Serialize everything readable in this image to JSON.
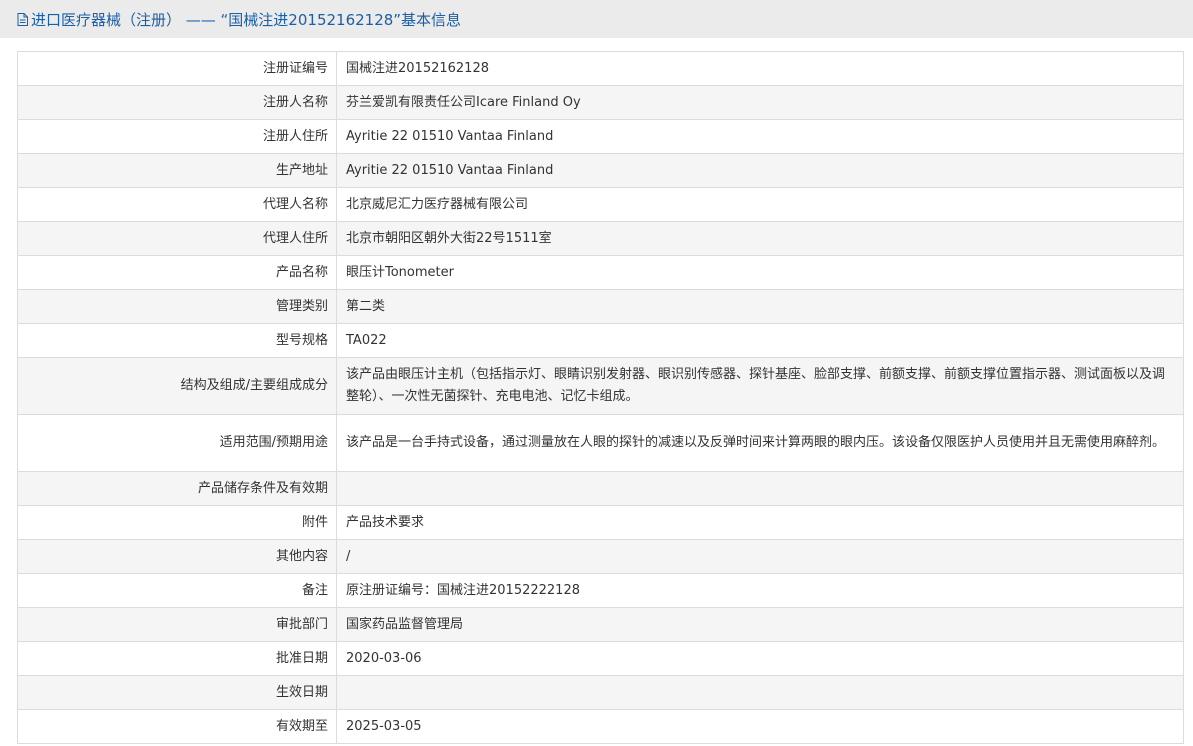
{
  "header": {
    "title": "进口医疗器械（注册） —— “国械注进20152162128”基本信息"
  },
  "rows": [
    {
      "label": "注册证编号",
      "value": "国械注进20152162128"
    },
    {
      "label": "注册人名称",
      "value": "芬兰爱凯有限责任公司Icare Finland Oy"
    },
    {
      "label": "注册人住所",
      "value": "Ayritie 22 01510 Vantaa Finland"
    },
    {
      "label": "生产地址",
      "value": "Ayritie 22 01510 Vantaa Finland"
    },
    {
      "label": "代理人名称",
      "value": "北京威尼汇力医疗器械有限公司"
    },
    {
      "label": "代理人住所",
      "value": "北京市朝阳区朝外大街22号1511室"
    },
    {
      "label": "产品名称",
      "value": "眼压计Tonometer"
    },
    {
      "label": "管理类别",
      "value": "第二类"
    },
    {
      "label": "型号规格",
      "value": "TA022"
    },
    {
      "label": "结构及组成/主要组成成分",
      "value": "该产品由眼压计主机（包括指示灯、眼睛识别发射器、眼识别传感器、探针基座、脸部支撑、前额支撑、前额支撑位置指示器、测试面板以及调整轮）、一次性无菌探针、充电电池、记忆卡组成。"
    },
    {
      "label": "适用范围/预期用途",
      "value": "该产品是一台手持式设备，通过测量放在人眼的探针的减速以及反弹时间来计算两眼的眼内压。该设备仅限医护人员使用并且无需使用麻醉剂。"
    },
    {
      "label": "产品储存条件及有效期",
      "value": ""
    },
    {
      "label": "附件",
      "value": "产品技术要求"
    },
    {
      "label": "其他内容",
      "value": "/"
    },
    {
      "label": "备注",
      "value": "原注册证编号：国械注进20152222128"
    },
    {
      "label": "审批部门",
      "value": "国家药品监督管理局"
    },
    {
      "label": "批准日期",
      "value": "2020-03-06"
    },
    {
      "label": "生效日期",
      "value": ""
    },
    {
      "label": "有效期至",
      "value": "2025-03-05"
    }
  ],
  "icons": {
    "header_icon": "document-icon"
  },
  "colors": {
    "title": "#1a5fa8",
    "header_bg": "#ebebeb",
    "stripe_bg": "#f5f5f5",
    "border": "#dcdcdc"
  }
}
